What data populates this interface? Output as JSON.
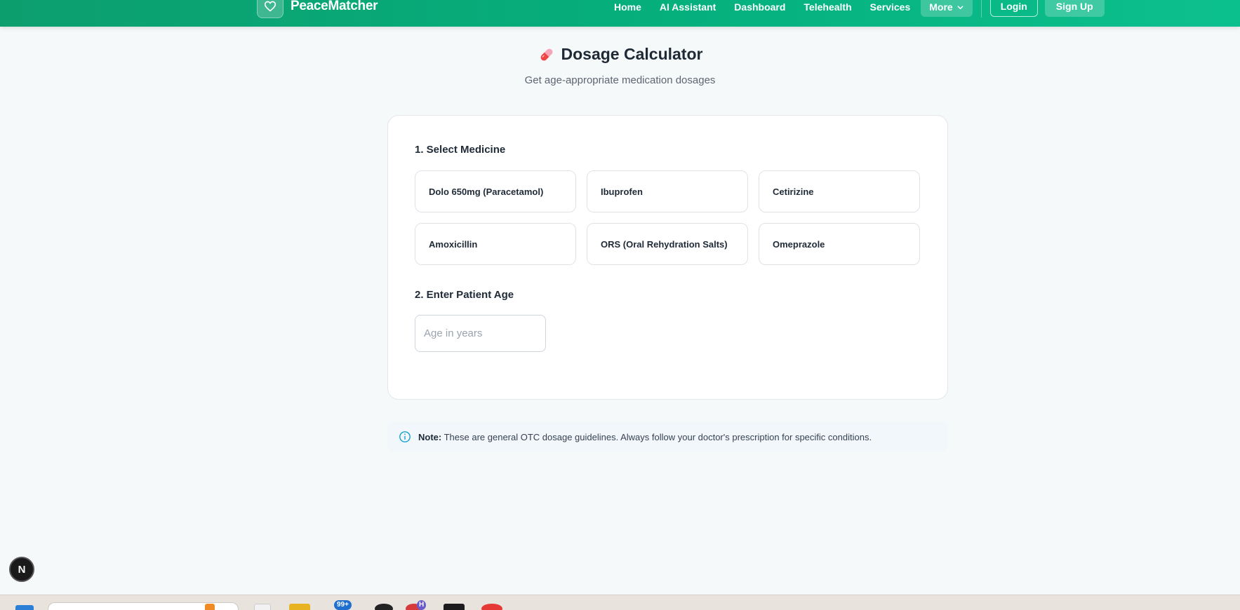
{
  "header": {
    "brand_name": "PeaceMatcher",
    "nav": [
      "Home",
      "AI Assistant",
      "Dashboard",
      "Telehealth",
      "Services"
    ],
    "more_label": "More",
    "login_label": "Login",
    "signup_label": "Sign Up"
  },
  "page": {
    "title": "Dosage Calculator",
    "subtitle": "Get age-appropriate medication dosages"
  },
  "form": {
    "step1_label": "1. Select Medicine",
    "medicines": [
      "Dolo 650mg (Paracetamol)",
      "Ibuprofen",
      "Cetirizine",
      "Amoxicillin",
      "ORS (Oral Rehydration Salts)",
      "Omeprazole"
    ],
    "step2_label": "2. Enter Patient Age",
    "age_placeholder": "Age in years",
    "age_value": ""
  },
  "note": {
    "prefix": "Note:",
    "text": "These are general OTC dosage guidelines. Always follow your doctor's prescription for specific conditions."
  },
  "floating_badge": "N",
  "taskbar": {
    "badge_count": "99+",
    "avatar_letter": "H"
  },
  "colors": {
    "header_gradient_start": "#0d9e6e",
    "header_gradient_end": "#0cc08e",
    "info_icon": "#1aa3d4",
    "pill_red": "#ef4444",
    "pill_pink": "#f6a5b8"
  },
  "icons": {
    "brand": "heart-icon",
    "more": "chevron-down-icon",
    "title": "pill-icon",
    "note": "info-icon"
  }
}
